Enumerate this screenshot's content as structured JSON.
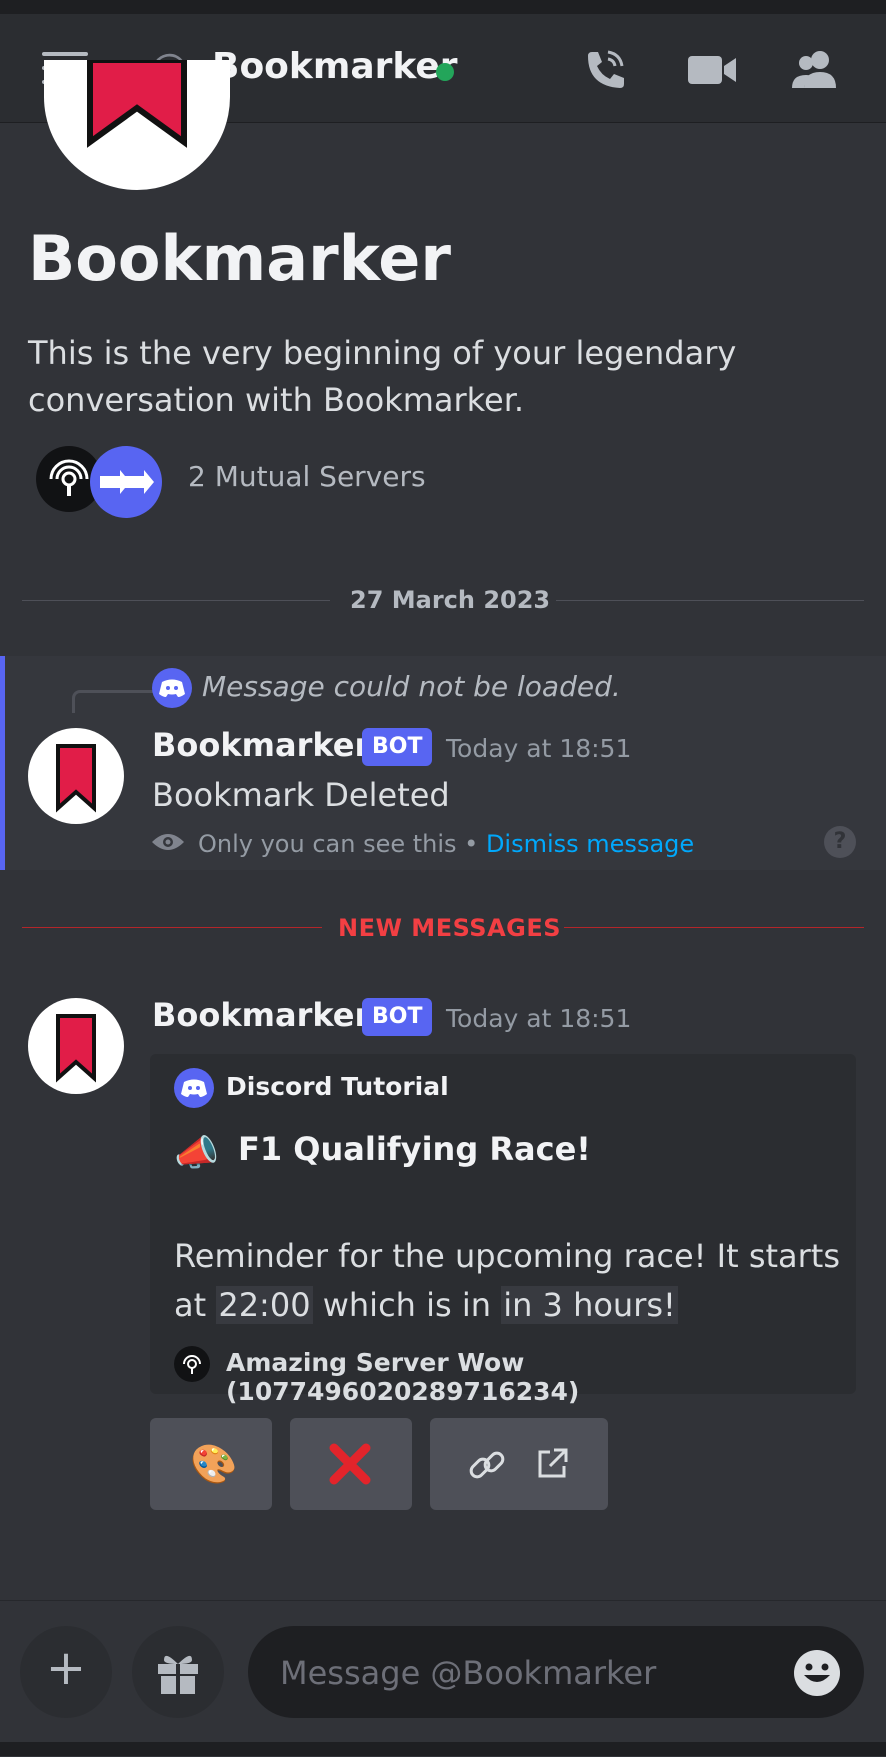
{
  "header": {
    "at_symbol": "@",
    "title": "Bookmarker",
    "status_color": "#23a55a"
  },
  "intro": {
    "name": "Bookmarker",
    "text": "This is the very beginning of your legendary conversation with Bookmarker.",
    "mutual_servers": "2 Mutual Servers"
  },
  "date_divider": "27 March 2023",
  "ephemeral": {
    "reply_text": "Message could not be loaded.",
    "username": "Bookmarker",
    "badge": "BOT",
    "time": "Today at 18:51",
    "content": "Bookmark Deleted",
    "notice": "Only you can see this",
    "separator": " • ",
    "dismiss": "Dismiss message",
    "help": "?"
  },
  "new_messages": "NEW MESSAGES",
  "message": {
    "username": "Bookmarker",
    "badge": "BOT",
    "time": "Today at 18:51",
    "embed": {
      "author": "Discord Tutorial",
      "title_icon": "📣",
      "title": "F1 Qualifying Race!",
      "desc_1": "Reminder for the upcoming race! It starts at ",
      "code_time": "22:00",
      "desc_2": " which is in ",
      "code_relative": "in 3 hours!",
      "footer": "Amazing Server Wow (1077496020289716234)"
    },
    "buttons": [
      {
        "icon": "palette-icon",
        "glyph": "🎨"
      },
      {
        "icon": "red-x-icon",
        "glyph": "❌"
      },
      {
        "icon": "link-icon"
      }
    ]
  },
  "composer": {
    "placeholder": "Message @Bookmarker",
    "add_glyph": "+"
  },
  "colors": {
    "accent": "#5865f2",
    "new_messages": "#f23f43",
    "link": "#00a8fc",
    "bookmark_red": "#e11d48"
  }
}
